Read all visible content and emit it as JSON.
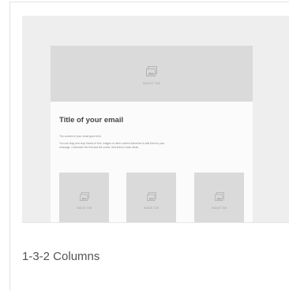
{
  "template": {
    "name": "1-3-2 Columns",
    "preview": {
      "hero_label": "IMAGE TAB",
      "email_title": "Title of your email",
      "body_line_1": "The content of your email goes here.",
      "body_line_2": "You can drag and drop blocks of text, images or other content elements to add them to your",
      "body_line_3": "message. Customize the font and the colors. Add links to track clicks.",
      "columns": [
        {
          "label": "IMAGE TAB",
          "icon": "image-icon"
        },
        {
          "label": "IMAGE TAB",
          "icon": "image-icon"
        },
        {
          "label": "IMAGE TAB",
          "icon": "image-icon"
        }
      ],
      "colors": {
        "canvas": "#eeeeee",
        "placeholder": "#dadada",
        "email_background": "#fbfbfb"
      }
    }
  }
}
